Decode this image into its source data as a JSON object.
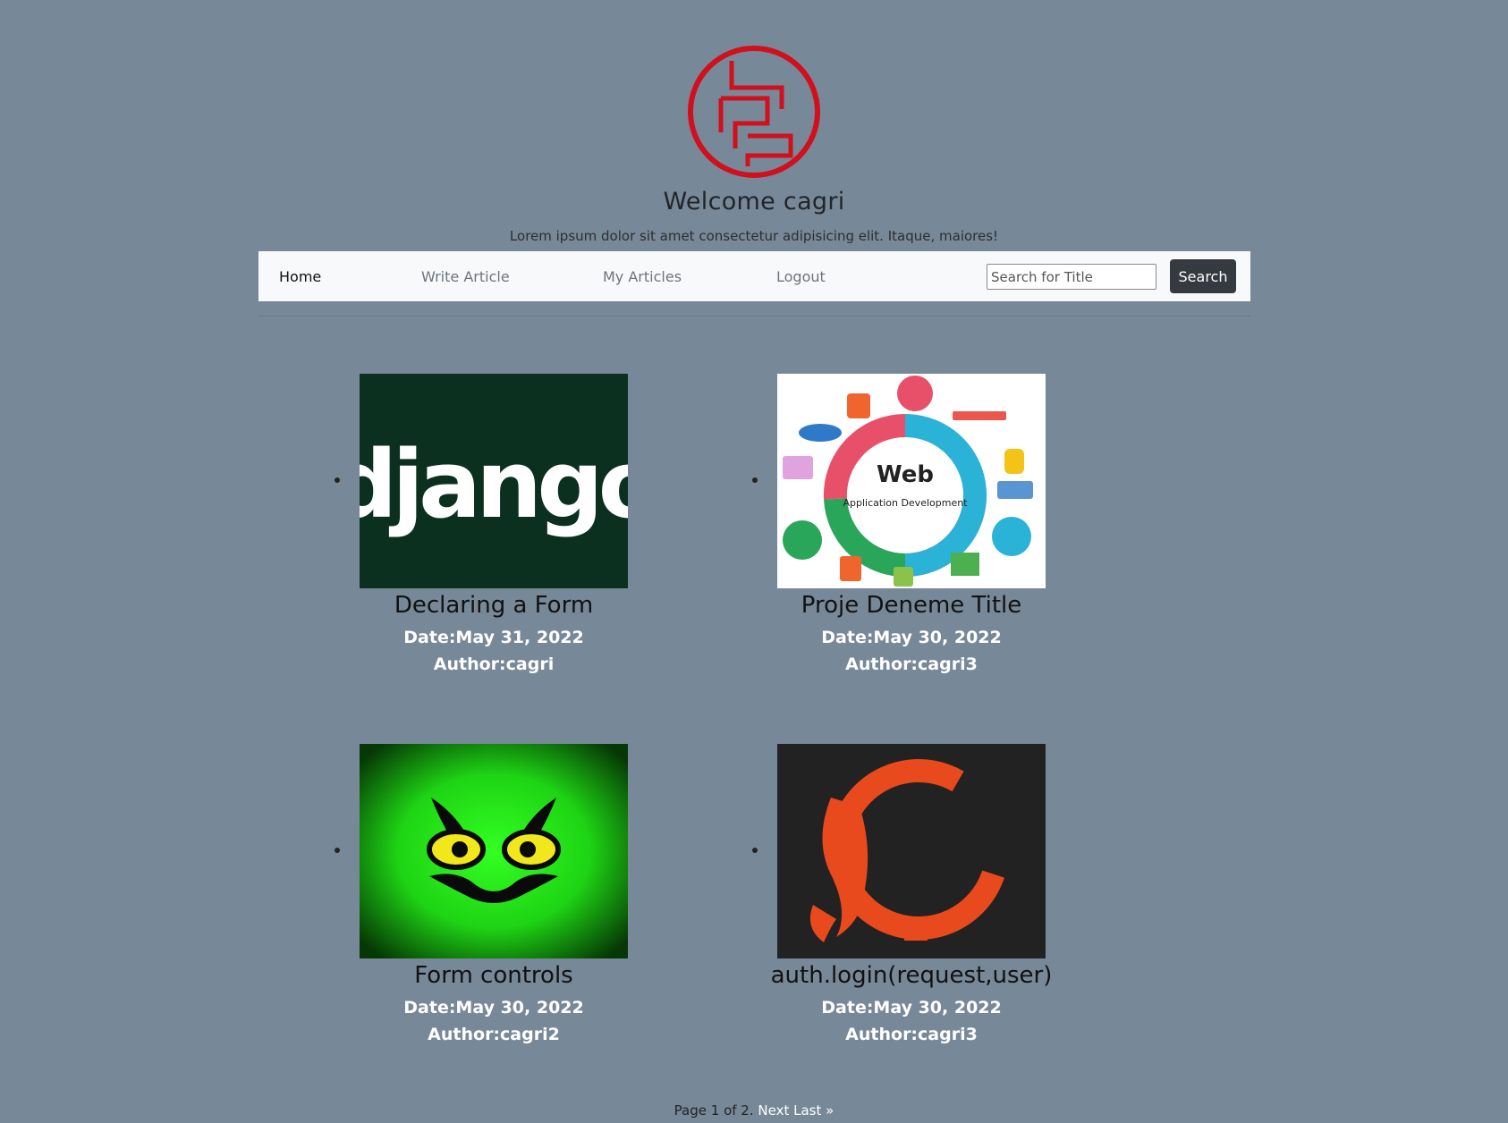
{
  "header": {
    "welcome": "Welcome cagri",
    "subtitle": "Lorem ipsum dolor sit amet consectetur adipisicing elit. Itaque, maiores!",
    "logo_color": "#d0101c"
  },
  "nav": {
    "home": "Home",
    "write_article": "Write Article",
    "my_articles": "My Articles",
    "logout": "Logout",
    "search_placeholder": "Search for Title",
    "search_button": "Search"
  },
  "articles": [
    {
      "title": "Declaring a Form",
      "date": "Date:May 31, 2022",
      "author": "Author:cagri",
      "image_icon": "django-logo",
      "image_text": "django"
    },
    {
      "title": "Proje Deneme Title",
      "date": "Date:May 30, 2022",
      "author": "Author:cagri3",
      "image_icon": "web-development-diagram",
      "image_text": "Web",
      "image_subtext": "Application Development"
    },
    {
      "title": "Form controls",
      "date": "Date:May 30, 2022",
      "author": "Author:cagri2",
      "image_icon": "green-monster-eyes"
    },
    {
      "title": "auth.login(request,user)",
      "date": "Date:May 30, 2022",
      "author": "Author:cagri3",
      "image_icon": "koi-fish-painting"
    }
  ],
  "pagination": {
    "text": "Page 1 of 2.",
    "next": "Next",
    "last": "Last »"
  }
}
